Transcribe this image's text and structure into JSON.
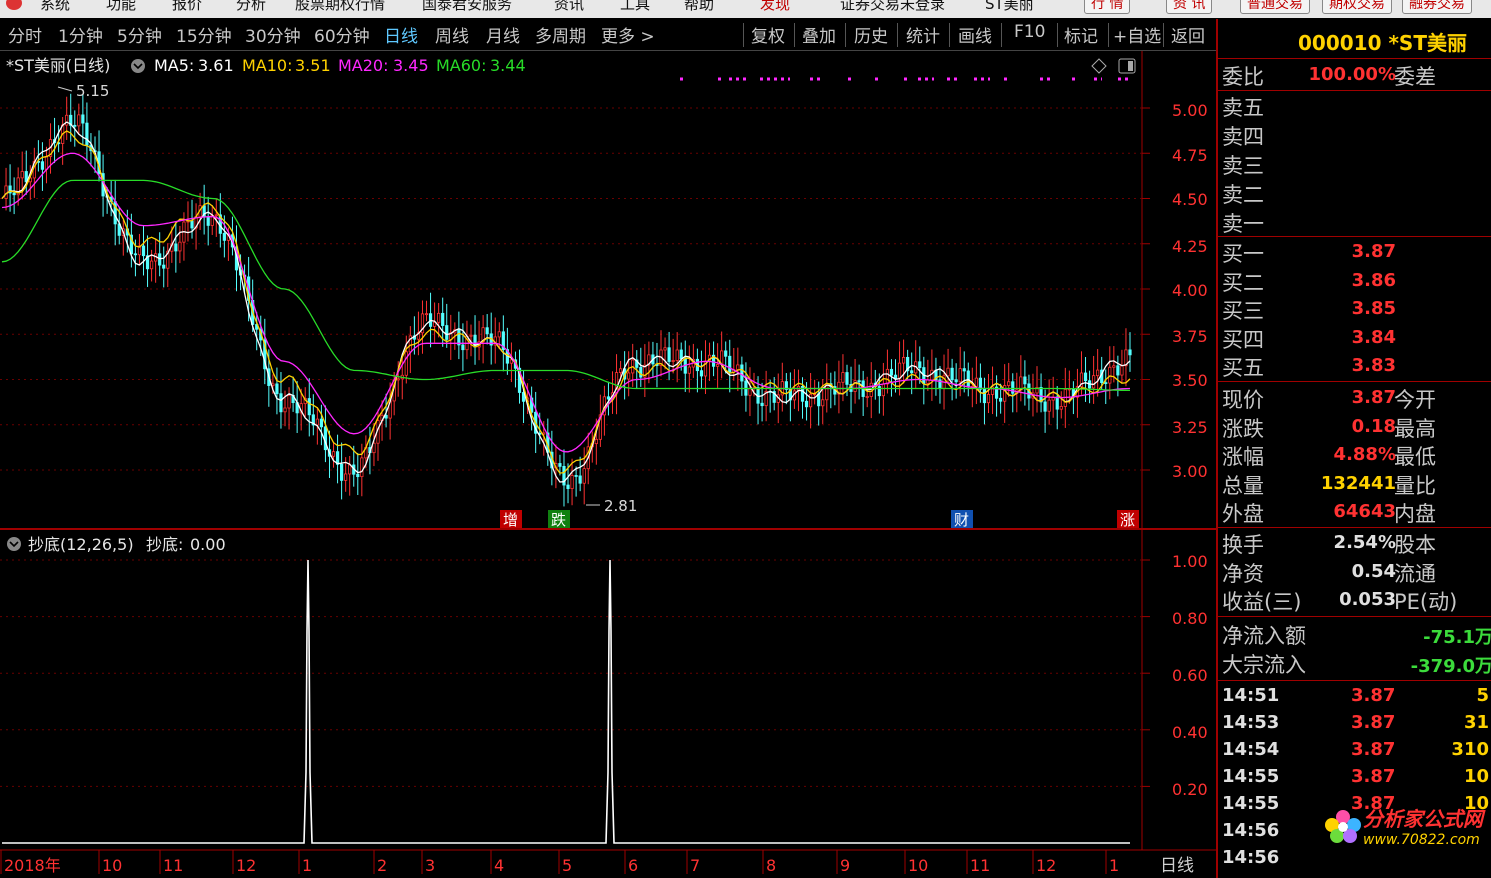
{
  "menubar": {
    "items": [
      "系统",
      "功能",
      "报价",
      "分析",
      "股票期权行情",
      "国泰君安服务",
      "资讯",
      "工具",
      "帮助"
    ],
    "active": "发现",
    "login_status": "证券交易未登录",
    "stock_name": "ST美丽",
    "buttons": [
      "行 情",
      "资 讯",
      "普通交易",
      "期权交易",
      "融券交易"
    ]
  },
  "toolbar": {
    "periods": [
      "分时",
      "1分钟",
      "5分钟",
      "15分钟",
      "30分钟",
      "60分钟",
      "日线",
      "周线",
      "月线",
      "多周期",
      "更多 >"
    ],
    "active_period": "日线",
    "tools": [
      "复权",
      "叠加",
      "历史",
      "统计",
      "画线",
      "F10",
      "标记",
      "+自选",
      "返回"
    ]
  },
  "main_chart": {
    "title": "*ST美丽(日线)",
    "ma": [
      {
        "label": "MA5:",
        "value": "3.61",
        "color": "#ffffff"
      },
      {
        "label": "MA10:",
        "value": "3.51",
        "color": "#ffd200"
      },
      {
        "label": "MA20:",
        "value": "3.45",
        "color": "#ff28ff"
      },
      {
        "label": "MA60:",
        "value": "3.44",
        "color": "#28dc28"
      }
    ],
    "high_label": "5.15",
    "low_label": "2.81",
    "price_axis": [
      "5.00",
      "4.75",
      "4.50",
      "4.25",
      "4.00",
      "3.75",
      "3.50",
      "3.25",
      "3.00"
    ],
    "markers": [
      {
        "text": "增",
        "bg": "#c00000"
      },
      {
        "text": "跌",
        "bg": "#108010"
      },
      {
        "text": "财",
        "bg": "#1050b0"
      },
      {
        "text": "涨",
        "bg": "#c00000"
      }
    ]
  },
  "indicator": {
    "title": "抄底(12,26,5)",
    "value_label": "抄底:",
    "value": "0.00",
    "axis": [
      "1.00",
      "0.80",
      "0.60",
      "0.40",
      "0.20"
    ]
  },
  "time_axis": [
    "2018年",
    "10",
    "11",
    "12",
    "1",
    "2",
    "3",
    "4",
    "5",
    "6",
    "7",
    "8",
    "9",
    "10",
    "11",
    "12",
    "1"
  ],
  "period_badge": "日线",
  "chart_data": [
    {
      "type": "candlestick",
      "title": "*ST美丽(日线)",
      "x": [
        "2018年",
        "10",
        "11",
        "12",
        "1",
        "2",
        "3",
        "4",
        "5",
        "6",
        "7",
        "8",
        "9",
        "10",
        "11",
        "12",
        "1"
      ],
      "ylim": [
        2.75,
        5.2
      ],
      "series": [
        {
          "name": "MA5",
          "approx_values": [
            4.5,
            4.9,
            4.15,
            4.4,
            3.4,
            3.0,
            3.8,
            3.7,
            2.95,
            3.6,
            3.6,
            3.4,
            3.45,
            3.55,
            3.45,
            3.4,
            3.61
          ]
        },
        {
          "name": "MA10",
          "approx_values": [
            4.5,
            4.85,
            4.25,
            4.45,
            3.5,
            3.1,
            3.75,
            3.7,
            3.0,
            3.55,
            3.6,
            3.45,
            3.45,
            3.5,
            3.45,
            3.4,
            3.51
          ]
        },
        {
          "name": "MA20",
          "approx_values": [
            4.45,
            4.75,
            4.35,
            4.4,
            3.6,
            3.2,
            3.7,
            3.7,
            3.1,
            3.5,
            3.6,
            3.45,
            3.45,
            3.5,
            3.45,
            3.4,
            3.45
          ]
        },
        {
          "name": "MA60",
          "approx_values": [
            4.15,
            4.6,
            4.6,
            4.5,
            4.0,
            3.55,
            3.5,
            3.55,
            3.55,
            3.45,
            3.45,
            3.45,
            3.45,
            3.45,
            3.45,
            3.45,
            3.44
          ]
        }
      ],
      "annotations": [
        "5.15",
        "2.81"
      ]
    },
    {
      "type": "line",
      "title": "抄底(12,26,5)",
      "x": [
        "2018年",
        "10",
        "11",
        "12",
        "1",
        "2",
        "3",
        "4",
        "5",
        "6",
        "7",
        "8",
        "9",
        "10",
        "11",
        "12",
        "1"
      ],
      "ylim": [
        0,
        1.05
      ],
      "series": [
        {
          "name": "抄底",
          "spikes": [
            {
              "date_near": "1",
              "value": 1.0
            },
            {
              "date_near": "6",
              "value": 1.0
            }
          ],
          "baseline": 0.0
        }
      ]
    }
  ],
  "quote": {
    "code_name": "000010 *ST美丽",
    "weibi": {
      "label": "委比",
      "value": "100.00%",
      "label2": "委差"
    },
    "asks": [
      "卖五",
      "卖四",
      "卖三",
      "卖二",
      "卖一"
    ],
    "bids": [
      {
        "label": "买一",
        "price": "3.87"
      },
      {
        "label": "买二",
        "price": "3.86"
      },
      {
        "label": "买三",
        "price": "3.85"
      },
      {
        "label": "买四",
        "price": "3.84"
      },
      {
        "label": "买五",
        "price": "3.83"
      }
    ],
    "stats": [
      {
        "label": "现价",
        "value": "3.87",
        "label2": "今开",
        "color": "red"
      },
      {
        "label": "涨跌",
        "value": "0.18",
        "label2": "最高",
        "color": "red"
      },
      {
        "label": "涨幅",
        "value": "4.88%",
        "label2": "最低",
        "color": "red"
      },
      {
        "label": "总量",
        "value": "132441",
        "label2": "量比",
        "color": "yel"
      },
      {
        "label": "外盘",
        "value": "64643",
        "label2": "内盘",
        "color": "red"
      }
    ],
    "stats2": [
      {
        "label": "换手",
        "value": "2.54%",
        "label2": "股本"
      },
      {
        "label": "净资",
        "value": "0.54",
        "label2": "流通"
      },
      {
        "label": "收益(三)",
        "value": "0.053",
        "label2": "PE(动)"
      }
    ],
    "flows": [
      {
        "label": "净流入额",
        "value": "-75.1万"
      },
      {
        "label": "大宗流入",
        "value": "-379.0万"
      }
    ],
    "ticks": [
      {
        "time": "14:51",
        "price": "3.87",
        "vol": "5"
      },
      {
        "time": "14:53",
        "price": "3.87",
        "vol": "31"
      },
      {
        "time": "14:54",
        "price": "3.87",
        "vol": "310"
      },
      {
        "time": "14:55",
        "price": "3.87",
        "vol": "10"
      },
      {
        "time": "14:55",
        "price": "3.87",
        "vol": "10"
      },
      {
        "time": "14:56",
        "price": "",
        "vol": ""
      },
      {
        "time": "14:56",
        "price": "",
        "vol": ""
      }
    ]
  },
  "watermark": {
    "title": "分析家公式网",
    "url": "www.70822.com"
  }
}
